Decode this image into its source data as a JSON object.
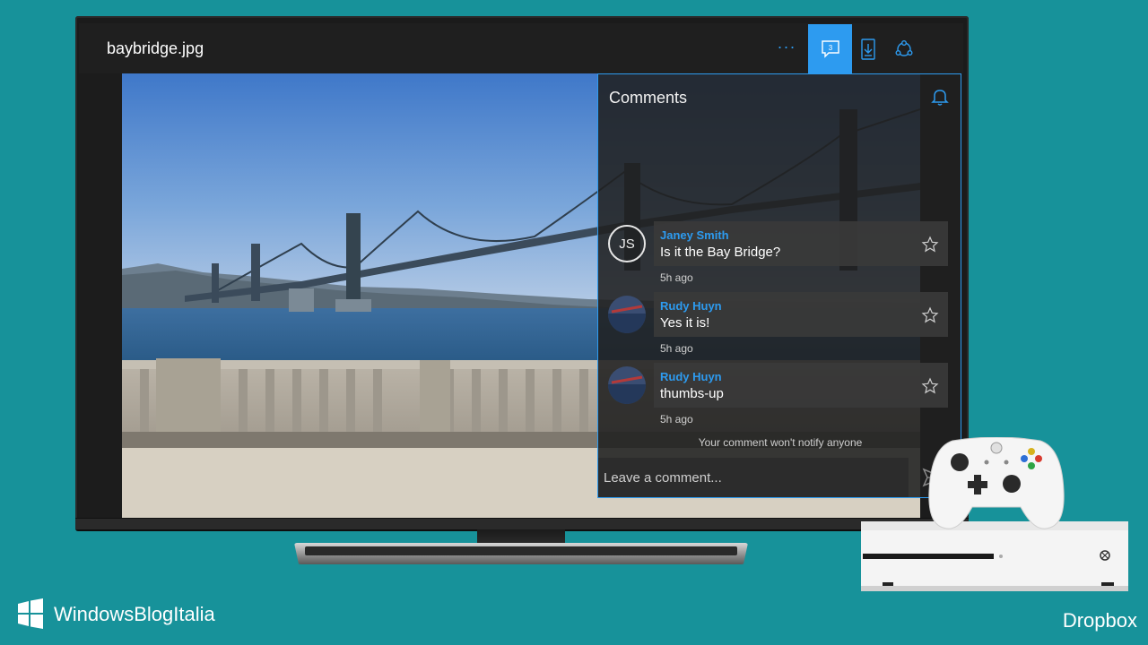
{
  "app": {
    "file_title": "baybridge.jpg",
    "more_label": "···",
    "comment_count": "3",
    "icons": [
      "more-icon",
      "comment-icon",
      "download-icon",
      "share-icon"
    ],
    "accent_color": "#2d9bf0"
  },
  "comments_panel": {
    "title": "Comments",
    "comments": [
      {
        "author": "Janey Smith",
        "initials": "JS",
        "text": "Is it the Bay Bridge?",
        "time": "5h ago"
      },
      {
        "author": "Rudy Huyn",
        "initials": "",
        "text": "Yes it is!",
        "time": "5h ago"
      },
      {
        "author": "Rudy Huyn",
        "initials": "",
        "text": "thumbs-up",
        "time": "5h ago"
      }
    ],
    "notify_note": "Your comment won't notify anyone",
    "input_placeholder": "Leave a comment..."
  },
  "branding": {
    "site_name": "WindowsBlogItalia",
    "app_name": "Dropbox"
  },
  "colors": {
    "background": "#17929a",
    "accent": "#2d9bf0",
    "panel": "#202020"
  }
}
